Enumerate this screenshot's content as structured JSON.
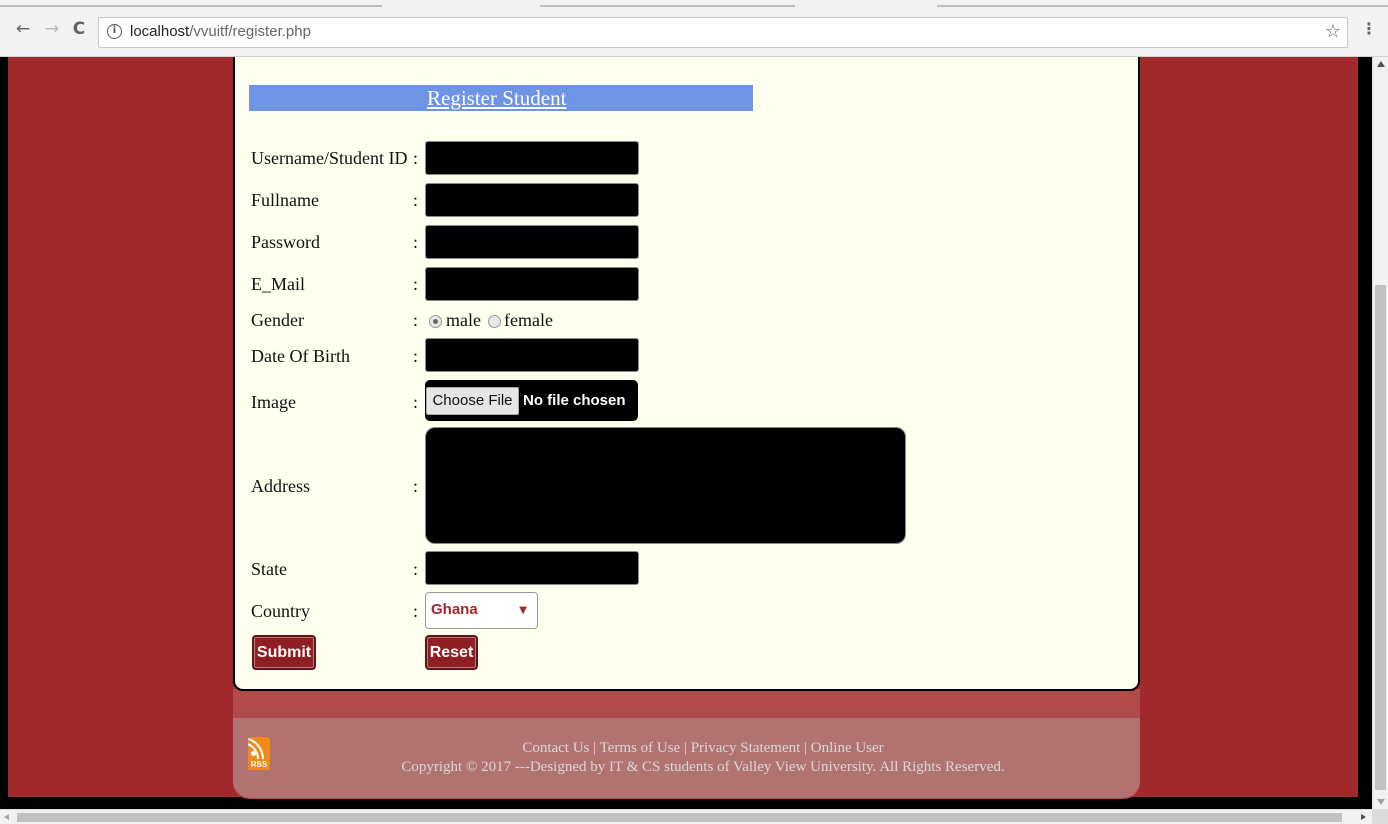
{
  "browser": {
    "url_host": "localhost",
    "url_path": "/vvuitf/register.php",
    "back_icon": "←",
    "forward_icon": "→",
    "reload_icon": "C",
    "info_icon": "i",
    "star_icon": "☆",
    "menu_icon": "⋮"
  },
  "form": {
    "title": "Register Student",
    "fields": {
      "username_label": "Username/Student ID",
      "fullname_label": "Fullname",
      "password_label": "Password",
      "email_label": "E_Mail",
      "gender_label": "Gender",
      "dob_label": "Date Of Birth",
      "image_label": "Image",
      "address_label": "Address",
      "state_label": "State",
      "country_label": "Country"
    },
    "colon": ":",
    "gender_options": [
      "male",
      "female"
    ],
    "gender_selected": "male",
    "file_button": "Choose File",
    "file_status": "No file chosen",
    "country_value": "Ghana",
    "submit_label": "Submit",
    "reset_label": "Reset"
  },
  "footer": {
    "rss_text": "RSS",
    "links": [
      "Contact Us",
      "Terms of Use",
      "Privacy Statement",
      "Online User"
    ],
    "links_line": "Contact Us | Terms of Use | Privacy Statement | Online User",
    "copyright": "Copyright © 2017 ---Designed by IT & CS students of Valley View University. All Rights Reserved."
  },
  "colors": {
    "page_bg": "#a0292b",
    "card_bg": "#fffff0",
    "title_bar": "#6e94e6",
    "button_bg": "#8e1f22"
  }
}
